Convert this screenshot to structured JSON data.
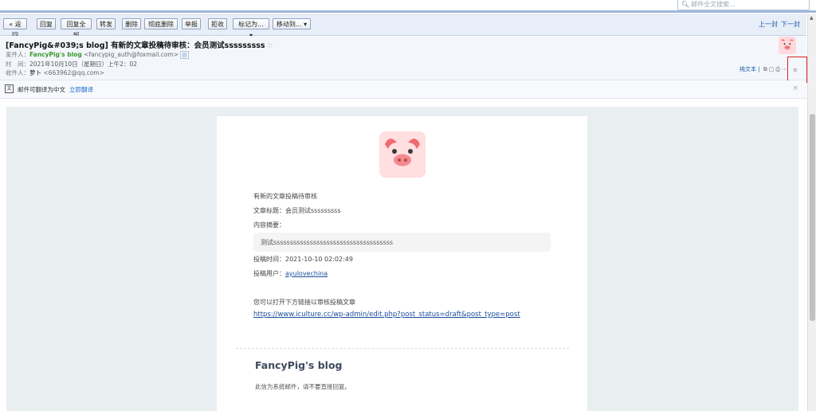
{
  "search": {
    "placeholder": "邮件全文搜索..."
  },
  "toolbar": {
    "back": "« 返回",
    "reply": "回复",
    "reply_all": "回复全部",
    "forward": "转发",
    "delete": "删除",
    "delete_permanently": "彻底删除",
    "report": "举报",
    "reject": "拒收",
    "mark_as": "标记为...",
    "move_to": "移动到...",
    "prev": "上一封",
    "next": "下一封"
  },
  "header": {
    "subject": "[FancyPig&#039;s blog] 有新的文章投稿待审核：会员测试sssssssss",
    "from_label": "发件人：",
    "from_name": "FancyPig's blog",
    "from_addr": "<fancypig_auth@foxmail.com>",
    "time_label": "时　间：",
    "time_value": "2021年10月10日（星期日）上午2：02",
    "to_label": "收件人：",
    "to_name": "萝卜",
    "to_addr": "<663962@qq.com>",
    "plain_text": "纯文本"
  },
  "translate": {
    "text": "邮件可翻译为中文",
    "link": "立即翻译"
  },
  "email": {
    "intro": "有新的文章投稿待审核",
    "title_label": "文章标题：",
    "title_value": "会员测试sssssssss",
    "summary_label": "内容摘要：",
    "summary_value": "测试ssssssssssssssssssssssssssssssssssss",
    "time_label": "投稿时间：",
    "time_value": "2021-10-10 02:02:49",
    "user_label": "投稿用户：",
    "user_value": "ayulovechina",
    "open_hint": "您可以打开下方链接以审核投稿文章",
    "url": "https://www.iculture.cc/wp-admin/edit.php?post_status=draft&post_type=post",
    "site_name": "FancyPig's blog",
    "system_note": "此信为系统邮件，请不要直接回复。"
  },
  "colors": {
    "accent": "#1e5aa8",
    "highlight_box": "#e02020",
    "sender_green": "#3b9a2e"
  }
}
